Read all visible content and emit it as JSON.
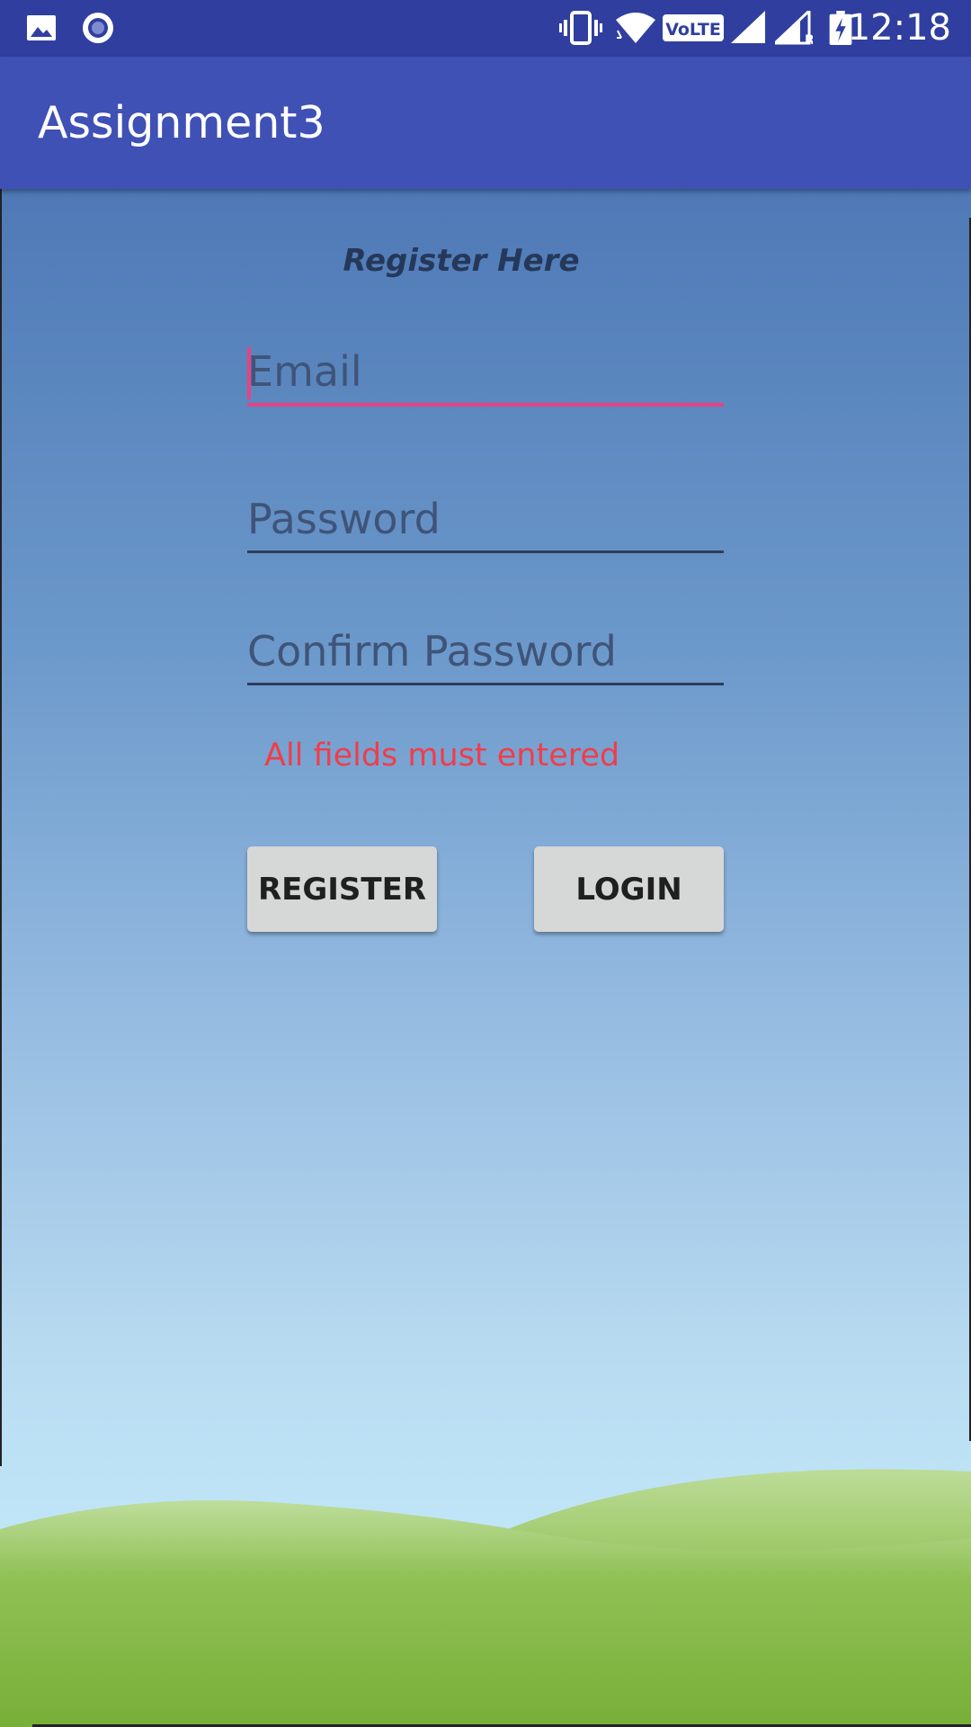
{
  "status_bar": {
    "time": "12:18",
    "left_icons": [
      "image-icon",
      "record-icon"
    ],
    "right_icons": [
      "vibrate-icon",
      "wifi-icon",
      "volte-icon",
      "signal-icon",
      "signal-roaming-icon",
      "battery-charging-icon"
    ],
    "volte_label": "VoLTE",
    "roaming_label": "R"
  },
  "app_bar": {
    "title": "Assignment3"
  },
  "form": {
    "heading": "Register Here",
    "email_placeholder": "Email",
    "password_placeholder": "Password",
    "confirm_placeholder": "Confirm Password",
    "error": "All fields must entered",
    "register_label": "REGISTER",
    "login_label": "LOGIN"
  },
  "colors": {
    "status_bar": "#303f9f",
    "app_bar": "#3f51b5",
    "accent": "#e84283",
    "error": "#ef3e4a",
    "button": "#d6d7d7"
  }
}
